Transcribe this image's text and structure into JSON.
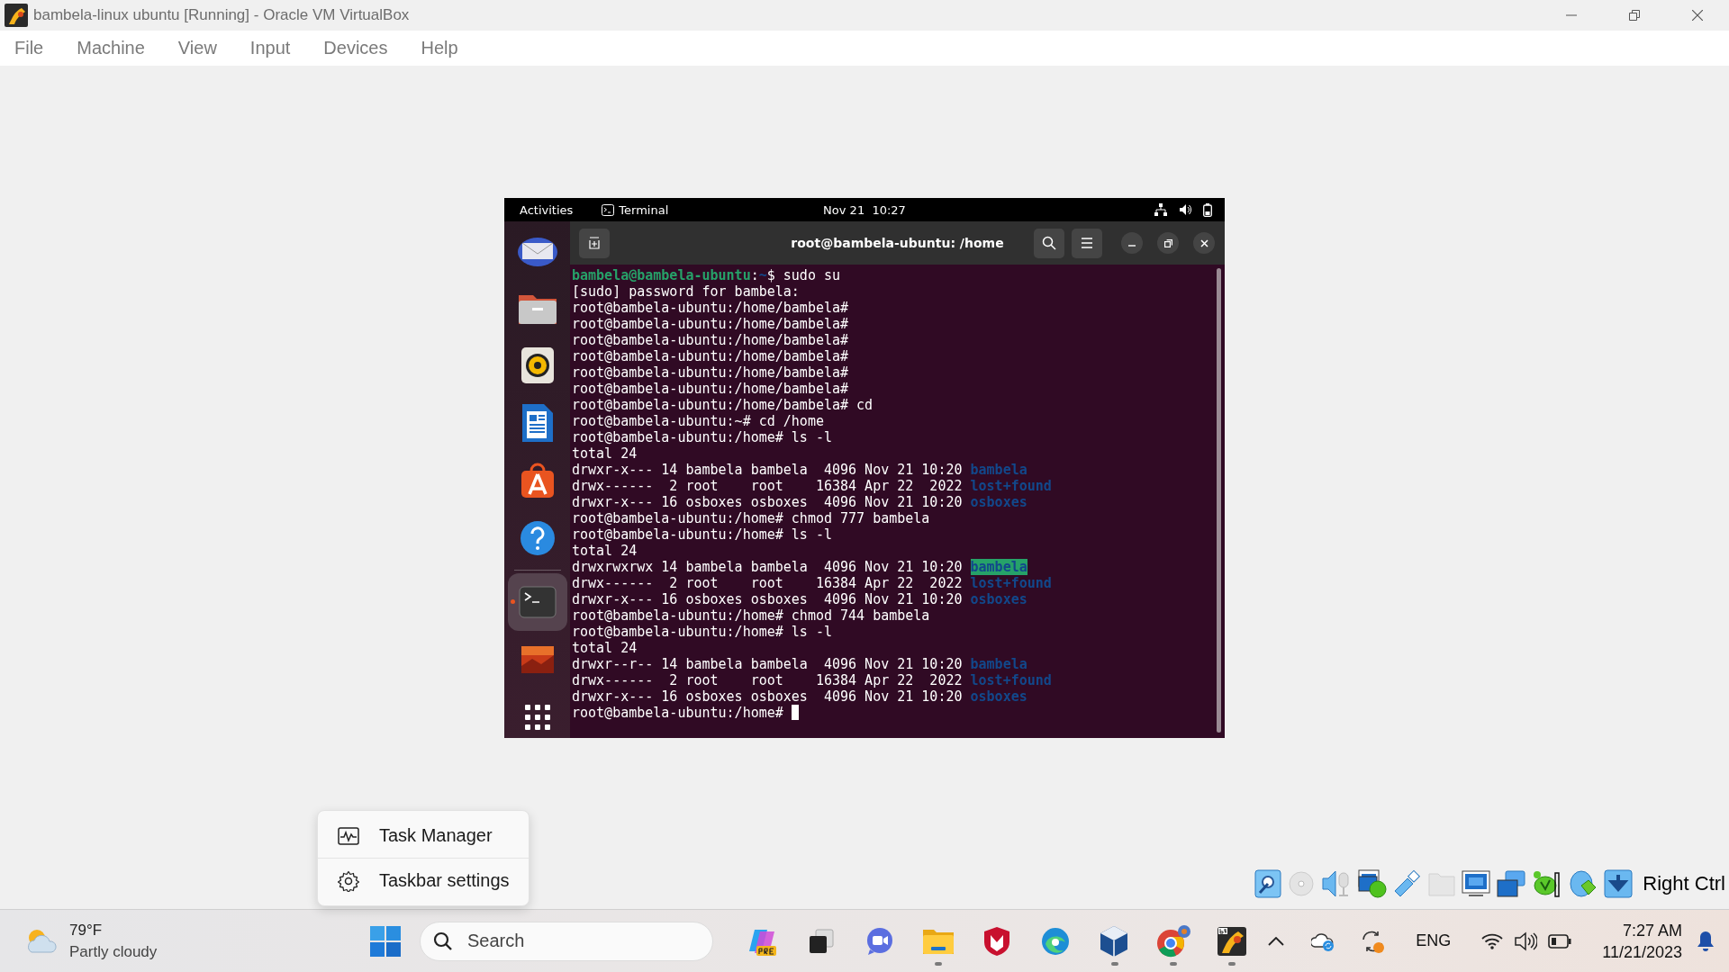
{
  "window": {
    "title": "bambela-linux ubuntu [Running] - Oracle VM VirtualBox"
  },
  "menu": [
    "File",
    "Machine",
    "View",
    "Input",
    "Devices",
    "Help"
  ],
  "guest": {
    "top_bar": {
      "activities": "Activities",
      "app": "Terminal",
      "clock": "Nov 21  10:27"
    },
    "dock": [
      {
        "kind": "mail",
        "selected": false,
        "running": false
      },
      {
        "kind": "files",
        "selected": false,
        "running": false
      },
      {
        "kind": "music",
        "selected": false,
        "running": false
      },
      {
        "kind": "writer",
        "selected": false,
        "running": false
      },
      {
        "kind": "software",
        "selected": false,
        "running": false
      },
      {
        "kind": "help",
        "selected": false,
        "running": false
      },
      {
        "kind": "separator"
      },
      {
        "kind": "terminal",
        "selected": true,
        "running": true
      },
      {
        "kind": "image",
        "selected": false,
        "running": false
      },
      {
        "kind": "apps",
        "selected": false,
        "running": false
      }
    ],
    "terminal": {
      "title": "root@bambela-ubuntu: /home",
      "lines": [
        {
          "segments": [
            {
              "kind": "user",
              "text": "bambela@bambela-ubuntu"
            },
            {
              "kind": "plain",
              "text": ":"
            },
            {
              "kind": "path",
              "text": "~"
            },
            {
              "kind": "plain",
              "text": "$ sudo su"
            }
          ]
        },
        {
          "segments": [
            {
              "kind": "plain",
              "text": "[sudo] password for bambela:"
            }
          ]
        },
        {
          "segments": [
            {
              "kind": "plain",
              "text": "root@bambela-ubuntu:/home/bambela#"
            }
          ]
        },
        {
          "segments": [
            {
              "kind": "plain",
              "text": "root@bambela-ubuntu:/home/bambela#"
            }
          ]
        },
        {
          "segments": [
            {
              "kind": "plain",
              "text": "root@bambela-ubuntu:/home/bambela#"
            }
          ]
        },
        {
          "segments": [
            {
              "kind": "plain",
              "text": "root@bambela-ubuntu:/home/bambela#"
            }
          ]
        },
        {
          "segments": [
            {
              "kind": "plain",
              "text": "root@bambela-ubuntu:/home/bambela#"
            }
          ]
        },
        {
          "segments": [
            {
              "kind": "plain",
              "text": "root@bambela-ubuntu:/home/bambela#"
            }
          ]
        },
        {
          "segments": [
            {
              "kind": "plain",
              "text": "root@bambela-ubuntu:/home/bambela# cd"
            }
          ]
        },
        {
          "segments": [
            {
              "kind": "plain",
              "text": "root@bambela-ubuntu:~# cd /home"
            }
          ]
        },
        {
          "segments": [
            {
              "kind": "plain",
              "text": "root@bambela-ubuntu:/home# ls -l"
            }
          ]
        },
        {
          "segments": [
            {
              "kind": "plain",
              "text": "total 24"
            }
          ]
        },
        {
          "segments": [
            {
              "kind": "plain",
              "text": "drwxr-x--- 14 bambela bambela  4096 Nov 21 10:20 "
            },
            {
              "kind": "dir",
              "text": "bambela"
            }
          ]
        },
        {
          "segments": [
            {
              "kind": "plain",
              "text": "drwx------  2 root    root    16384 Apr 22  2022 "
            },
            {
              "kind": "dir",
              "text": "lost+found"
            }
          ]
        },
        {
          "segments": [
            {
              "kind": "plain",
              "text": "drwxr-x--- 16 osboxes osboxes  4096 Nov 21 10:20 "
            },
            {
              "kind": "dir",
              "text": "osboxes"
            }
          ]
        },
        {
          "segments": [
            {
              "kind": "plain",
              "text": "root@bambela-ubuntu:/home# chmod 777 bambela"
            }
          ]
        },
        {
          "segments": [
            {
              "kind": "plain",
              "text": "root@bambela-ubuntu:/home# ls -l"
            }
          ]
        },
        {
          "segments": [
            {
              "kind": "plain",
              "text": "total 24"
            }
          ]
        },
        {
          "segments": [
            {
              "kind": "plain",
              "text": "drwxrwxrwx 14 bambela bambela  4096 Nov 21 10:20 "
            },
            {
              "kind": "dir-writable",
              "text": "bambela"
            }
          ]
        },
        {
          "segments": [
            {
              "kind": "plain",
              "text": "drwx------  2 root    root    16384 Apr 22  2022 "
            },
            {
              "kind": "dir",
              "text": "lost+found"
            }
          ]
        },
        {
          "segments": [
            {
              "kind": "plain",
              "text": "drwxr-x--- 16 osboxes osboxes  4096 Nov 21 10:20 "
            },
            {
              "kind": "dir",
              "text": "osboxes"
            }
          ]
        },
        {
          "segments": [
            {
              "kind": "plain",
              "text": "root@bambela-ubuntu:/home# chmod 744 bambela"
            }
          ]
        },
        {
          "segments": [
            {
              "kind": "plain",
              "text": "root@bambela-ubuntu:/home# ls -l"
            }
          ]
        },
        {
          "segments": [
            {
              "kind": "plain",
              "text": "total 24"
            }
          ]
        },
        {
          "segments": [
            {
              "kind": "plain",
              "text": "drwxr--r-- 14 bambela bambela  4096 Nov 21 10:20 "
            },
            {
              "kind": "dir",
              "text": "bambela"
            }
          ]
        },
        {
          "segments": [
            {
              "kind": "plain",
              "text": "drwx------  2 root    root    16384 Apr 22  2022 "
            },
            {
              "kind": "dir",
              "text": "lost+found"
            }
          ]
        },
        {
          "segments": [
            {
              "kind": "plain",
              "text": "drwxr-x--- 16 osboxes osboxes  4096 Nov 21 10:20 "
            },
            {
              "kind": "dir",
              "text": "osboxes"
            }
          ]
        },
        {
          "segments": [
            {
              "kind": "plain",
              "text": "root@bambela-ubuntu:/home# "
            }
          ],
          "cursor": true
        }
      ]
    }
  },
  "context_menu": [
    {
      "kind": "task-manager",
      "label": "Task Manager"
    },
    {
      "kind": "settings",
      "label": "Taskbar settings"
    }
  ],
  "host_key": "Right Ctrl",
  "taskbar": {
    "weather": {
      "temp": "79°F",
      "condition": "Partly cloudy"
    },
    "search": {
      "placeholder": "Search"
    },
    "apps": [
      {
        "kind": "copilot",
        "running": false
      },
      {
        "kind": "task-view",
        "running": false
      },
      {
        "kind": "meet",
        "running": false
      },
      {
        "kind": "explorer",
        "running": true
      },
      {
        "kind": "shield",
        "running": false
      },
      {
        "kind": "edge",
        "running": false
      },
      {
        "kind": "cube",
        "running": true
      },
      {
        "kind": "chrome",
        "running": true
      },
      {
        "kind": "vm",
        "running": true
      }
    ],
    "language": "ENG",
    "time": "7:27 AM",
    "date": "11/21/2023"
  }
}
